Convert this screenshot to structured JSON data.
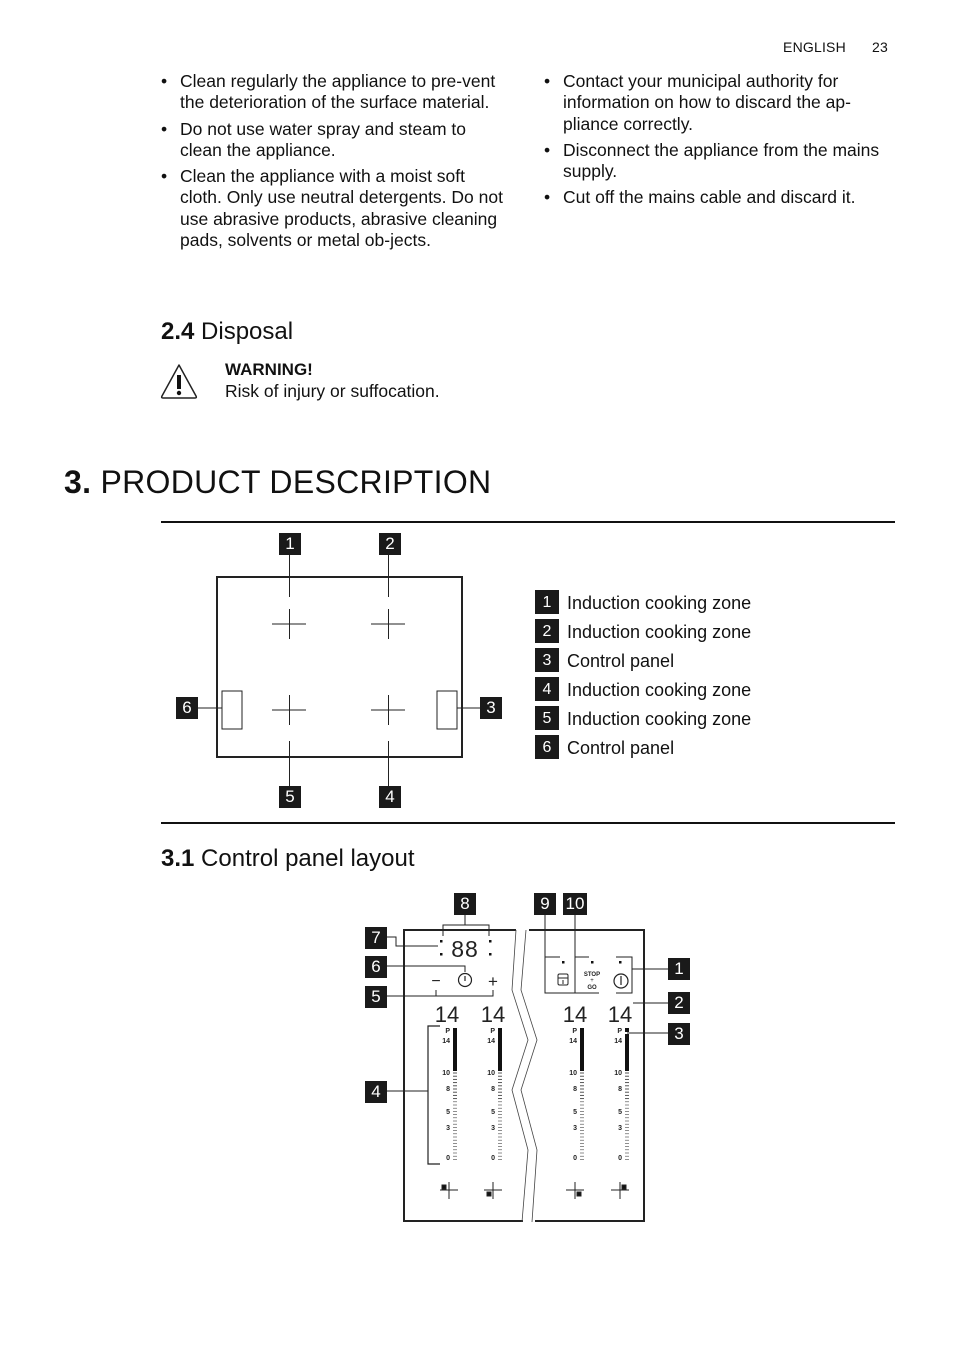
{
  "header": {
    "language": "ENGLISH",
    "page_number": "23"
  },
  "care_bullets_left": [
    "Clean regularly the appliance to pre-vent the deterioration of the surface material.",
    "Do not use water spray and steam to clean the appliance.",
    "Clean the appliance with a moist soft cloth. Only use neutral detergents. Do not use abrasive products, abrasive cleaning pads, solvents or metal ob-jects."
  ],
  "disposal_bullets_right": [
    "Contact your municipal authority for information on how to discard the ap-pliance correctly.",
    "Disconnect the appliance from the mains supply.",
    "Cut off the mains cable and discard it."
  ],
  "section_2_4": {
    "number": "2.4",
    "title": "Disposal",
    "warning_icon": "warning-triangle-icon",
    "warning_title": "WARNING!",
    "warning_text": "Risk of injury or suffocation."
  },
  "section_3": {
    "number": "3.",
    "title": "PRODUCT DESCRIPTION"
  },
  "hob_diagram": {
    "callouts": [
      "1",
      "2",
      "3",
      "4",
      "5",
      "6"
    ],
    "legend": [
      {
        "num": "1",
        "label": "Induction cooking zone"
      },
      {
        "num": "2",
        "label": "Induction cooking zone"
      },
      {
        "num": "3",
        "label": "Control panel"
      },
      {
        "num": "4",
        "label": "Induction cooking zone"
      },
      {
        "num": "5",
        "label": "Induction cooking zone"
      },
      {
        "num": "6",
        "label": "Control panel"
      }
    ]
  },
  "section_3_1": {
    "number": "3.1",
    "title": "Control panel layout"
  },
  "control_panel_diagram": {
    "callouts_left": [
      "7",
      "6",
      "5",
      "4"
    ],
    "callouts_top": [
      "8",
      "9",
      "10"
    ],
    "callouts_right": [
      "1",
      "2",
      "3"
    ],
    "timer_display": "88",
    "minus": "−",
    "plus": "+",
    "zone_displays": [
      "14",
      "14",
      "14",
      "14"
    ],
    "scale_labels": [
      "P",
      "14",
      "10",
      "8",
      "5",
      "3",
      "0"
    ],
    "stop_go_label_top": "STOP",
    "stop_go_label_mid": "+",
    "stop_go_label_bottom": "GO",
    "icons": [
      "timer-icon",
      "lock-icon",
      "stop-go-icon",
      "power-icon",
      "zone-indicator-icon"
    ]
  }
}
